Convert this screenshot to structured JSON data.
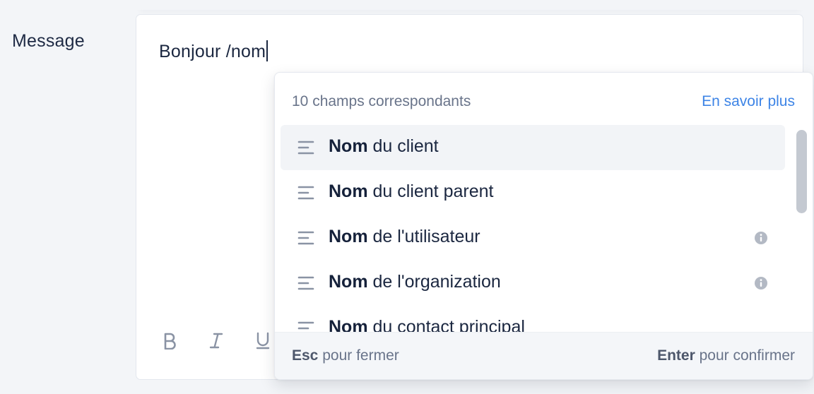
{
  "field": {
    "label": "Message"
  },
  "editor": {
    "text": "Bonjour /nom",
    "toolbar": {
      "bold_icon": "bold-icon",
      "italic_icon": "italic-icon",
      "underline_icon": "underline-icon"
    }
  },
  "suggestions": {
    "count_label": "10 champs correspondants",
    "learn_more": "En savoir plus",
    "items": [
      {
        "match": "Nom",
        "rest": " du client",
        "info": false,
        "active": true
      },
      {
        "match": "Nom",
        "rest": " du client parent",
        "info": false,
        "active": false
      },
      {
        "match": "Nom",
        "rest": " de l'utilisateur",
        "info": true,
        "active": false
      },
      {
        "match": "Nom",
        "rest": " de l'organization",
        "info": true,
        "active": false
      },
      {
        "match": "Nom",
        "rest": " du contact principal",
        "info": false,
        "active": false
      }
    ],
    "footer": {
      "esc_key": "Esc",
      "esc_text": " pour fermer",
      "enter_key": "Enter",
      "enter_text": " pour confirmer"
    }
  },
  "colors": {
    "accent": "#3d84e6",
    "text": "#1b2740",
    "muted": "#69748a",
    "active_row": "#f2f4f7"
  }
}
